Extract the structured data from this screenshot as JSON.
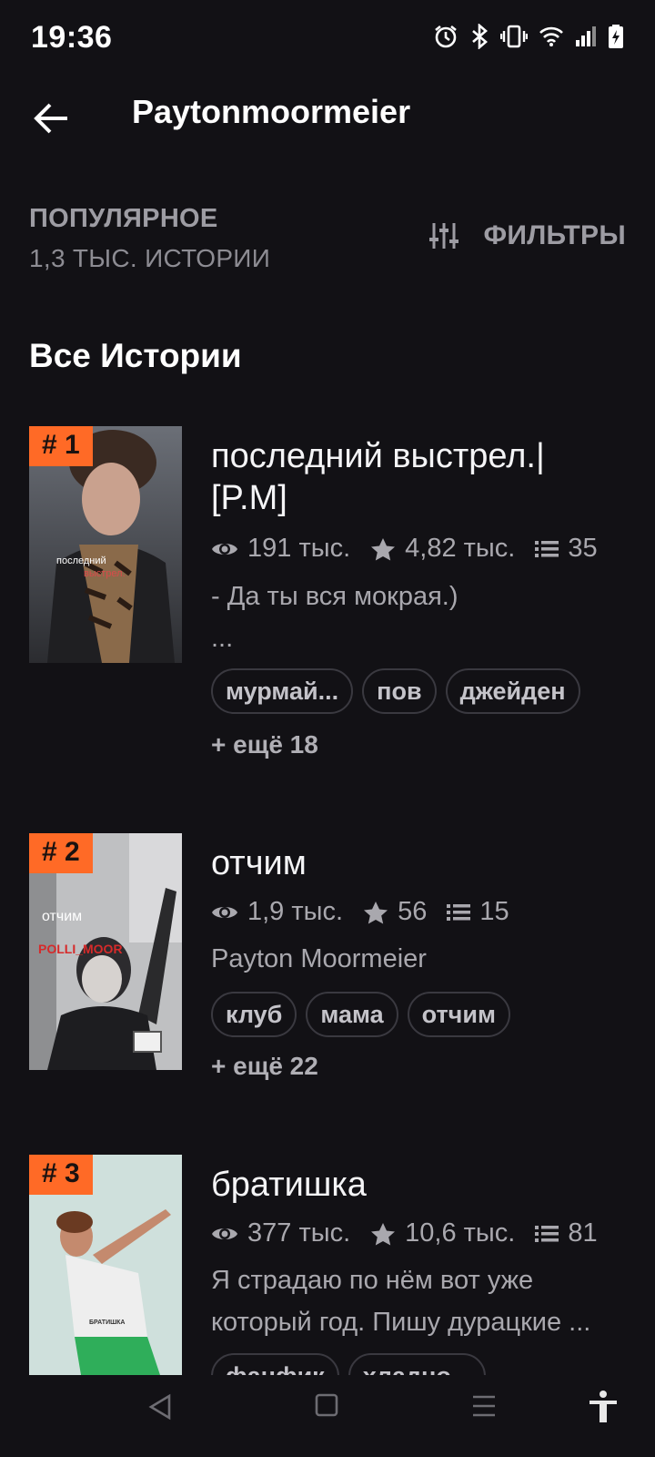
{
  "status": {
    "time": "19:36"
  },
  "header": {
    "title": "Paytonmoormeier",
    "back_label": "←"
  },
  "sort": {
    "title": "ПОПУЛЯРНОЕ",
    "count": "1,3 ТЫС. ИСТОРИИ"
  },
  "filters": {
    "label": "ФИЛЬТРЫ"
  },
  "section": {
    "title": "Все Истории"
  },
  "stories": [
    {
      "rank": "# 1",
      "title": "последний выстрел.| [P.M]",
      "reads": "191 тыс.",
      "votes": "4,82 тыс.",
      "parts": "35",
      "description": "- Да ты вся мокрая.)",
      "description2": "...",
      "cover_text1": "последний",
      "cover_text2": "выстрел.",
      "tags": [
        "мурмай...",
        "пов",
        "джейден"
      ],
      "more": "+ ещё 18"
    },
    {
      "rank": "# 2",
      "title": "отчим",
      "reads": "1,9 тыс.",
      "votes": "56",
      "parts": "15",
      "description": "Payton Moormeier",
      "cover_text1": "отчим",
      "cover_text2": "POLLI_MOOR",
      "tags": [
        "клуб",
        "мама",
        "отчим"
      ],
      "more": "+ ещё 22"
    },
    {
      "rank": "# 3",
      "title": "братишка",
      "reads": "377 тыс.",
      "votes": "10,6 тыс.",
      "parts": "81",
      "description": "Я страдаю по нём вот уже",
      "description2": "который год. Пишу дурацкие ...",
      "cover_text1": "БРАТИШКА",
      "tags": [
        "фанфик",
        "хладно..."
      ]
    }
  ],
  "colors": {
    "background": "#121115",
    "accent": "#ff6a26",
    "muted": "#a9a8ae"
  }
}
